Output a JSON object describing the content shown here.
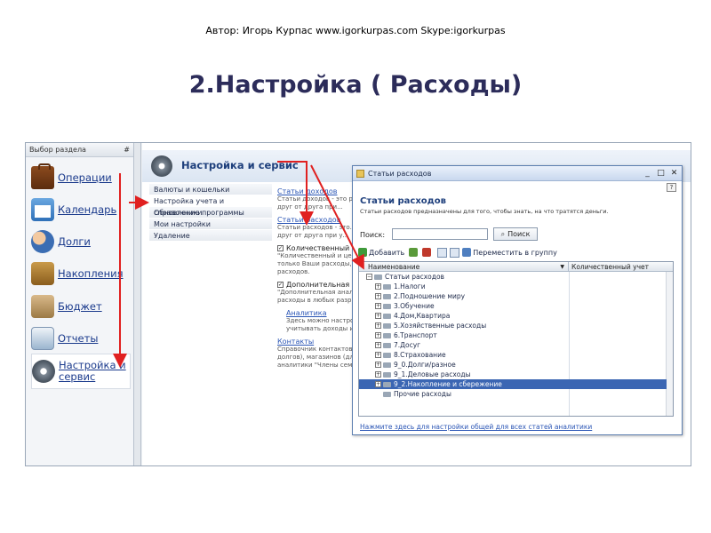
{
  "slide": {
    "author": "Автор: Игорь Курпас www.igorkurpas.com  Skype:igorkurpas",
    "title": "2.Настройка ( Расходы)"
  },
  "sections_panel": {
    "header": "Выбор раздела",
    "pin": "#",
    "items": [
      {
        "label": "Операции",
        "icon": "briefcase-icon"
      },
      {
        "label": "Календарь",
        "icon": "calendar-icon"
      },
      {
        "label": "Долги",
        "icon": "people-icon"
      },
      {
        "label": "Накопления",
        "icon": "chest-icon"
      },
      {
        "label": "Бюджет",
        "icon": "budget-icon"
      },
      {
        "label": "Отчеты",
        "icon": "report-icon"
      },
      {
        "label": "Настройка и сервис",
        "icon": "gear-icon"
      }
    ]
  },
  "main": {
    "title": "Настройка и сервис",
    "menu": [
      "Валюты и кошельки",
      "Настройка учета и справочники",
      "Обновление программы",
      "Мои настройки",
      "Удаление"
    ],
    "content": {
      "link1": "Статьи доходов",
      "text1": "Статьи доходов - это р... друг от друга при...",
      "link2": "Статьи расходов",
      "text2": "Статьи расходов - это... друг от друга при у...",
      "check1": "Количественный и",
      "check1_text": "\"Количественный и цен... только Ваши расходы, расходов.",
      "check2": "Дополнительная ан",
      "check2_text": "\"Дополнительная анали... расходы в любых разр...",
      "link3": "Аналитика",
      "text3": "Здесь можно настро... учитывать доходы и...",
      "link4": "Контакты",
      "text4": "Справочник контактов... долгов), магазинов (дл... аналитики \"Члены семь..."
    }
  },
  "dialog": {
    "title": "Статьи расходов",
    "heading": "Статьи расходов",
    "description": "Статьи расходов предназначены для того, чтобы знать, на что тратятся деньги.",
    "search_label": "Поиск:",
    "search_value": "",
    "search_button": "Поиск",
    "toolbar": {
      "add": "Добавить",
      "move": "Переместить в группу"
    },
    "columns": [
      "Наименование",
      "Количественный учет"
    ],
    "root": "Статьи расходов",
    "rows": [
      "1.Налоги",
      "2.Подношение миру",
      "3.Обучение",
      "4.Дом,Квартира",
      "5.Хозяйственные расходы",
      "6.Транспорт",
      "7.Досуг",
      "8.Страхование",
      "9_0.Долги/разное",
      "9_1.Деловые расходы",
      "9_2.Накопление и сбережение",
      "Прочие расходы"
    ],
    "selected_row": "9_2.Накопление и сбережение",
    "footer_link": "Нажмите здесь для настройки общей для всех статей аналитики"
  },
  "colors": {
    "arrow": "#e02020",
    "selection": "#3b66b3",
    "title": "#2c2c5a"
  }
}
